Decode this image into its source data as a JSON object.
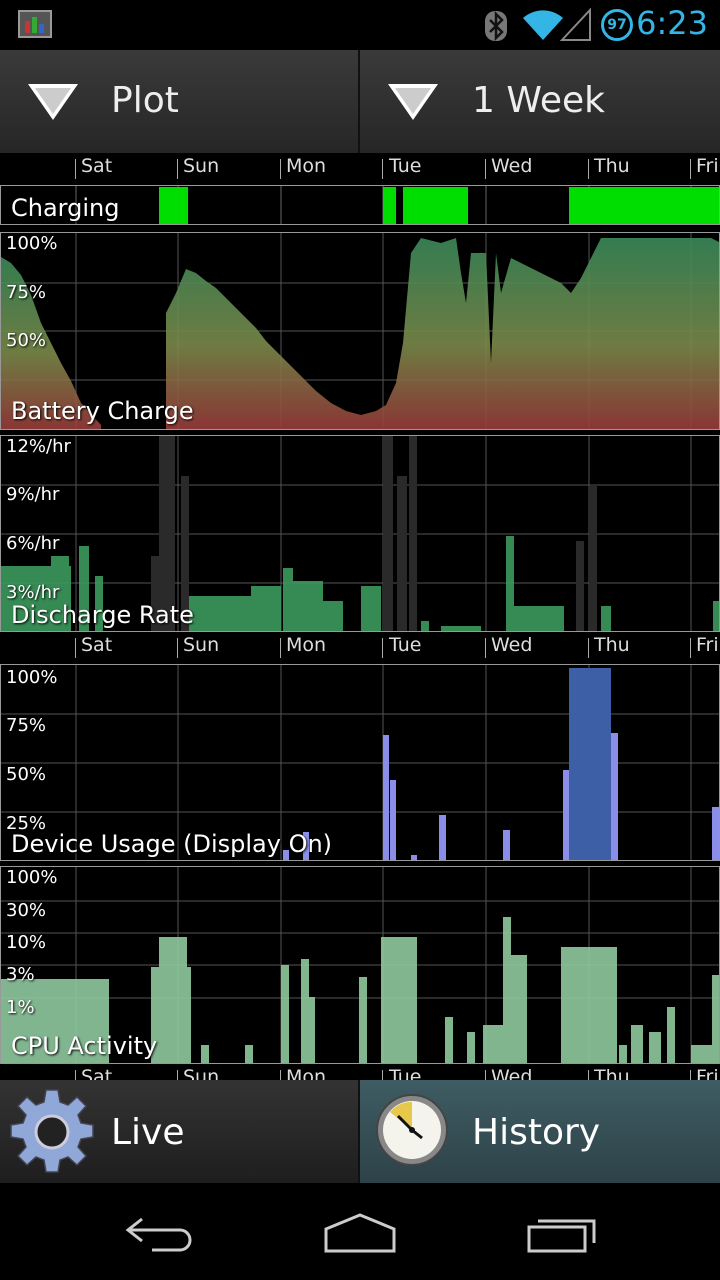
{
  "status_bar": {
    "time": "6:23",
    "battery_level": "97",
    "icons": [
      "app-notification-icon",
      "bluetooth-icon",
      "wifi-icon",
      "cell-signal-icon",
      "battery-icon"
    ],
    "accent_color": "#33b5e5"
  },
  "toolbar": {
    "plot_dropdown": "Plot",
    "range_dropdown": "1 Week"
  },
  "days": [
    "Sat",
    "Sun",
    "Mon",
    "Tue",
    "Wed",
    "Thu",
    "Fri"
  ],
  "charts": {
    "charging": {
      "title": "Charging"
    },
    "battery": {
      "title": "Battery Charge",
      "y_labels": [
        "100%",
        "75%",
        "50%"
      ]
    },
    "discharge": {
      "title": "Discharge Rate",
      "y_labels": [
        "12%/hr",
        "9%/hr",
        "6%/hr",
        "3%/hr"
      ]
    },
    "usage": {
      "title": "Device Usage (Display On)",
      "y_labels": [
        "100%",
        "75%",
        "50%",
        "25%"
      ]
    },
    "cpu": {
      "title": "CPU Activity",
      "y_labels": [
        "100%",
        "30%",
        "10%",
        "3%",
        "1%"
      ]
    }
  },
  "bottom_tabs": {
    "live": "Live",
    "history": "History"
  },
  "nav": [
    "back-icon",
    "home-icon",
    "recent-apps-icon"
  ]
}
